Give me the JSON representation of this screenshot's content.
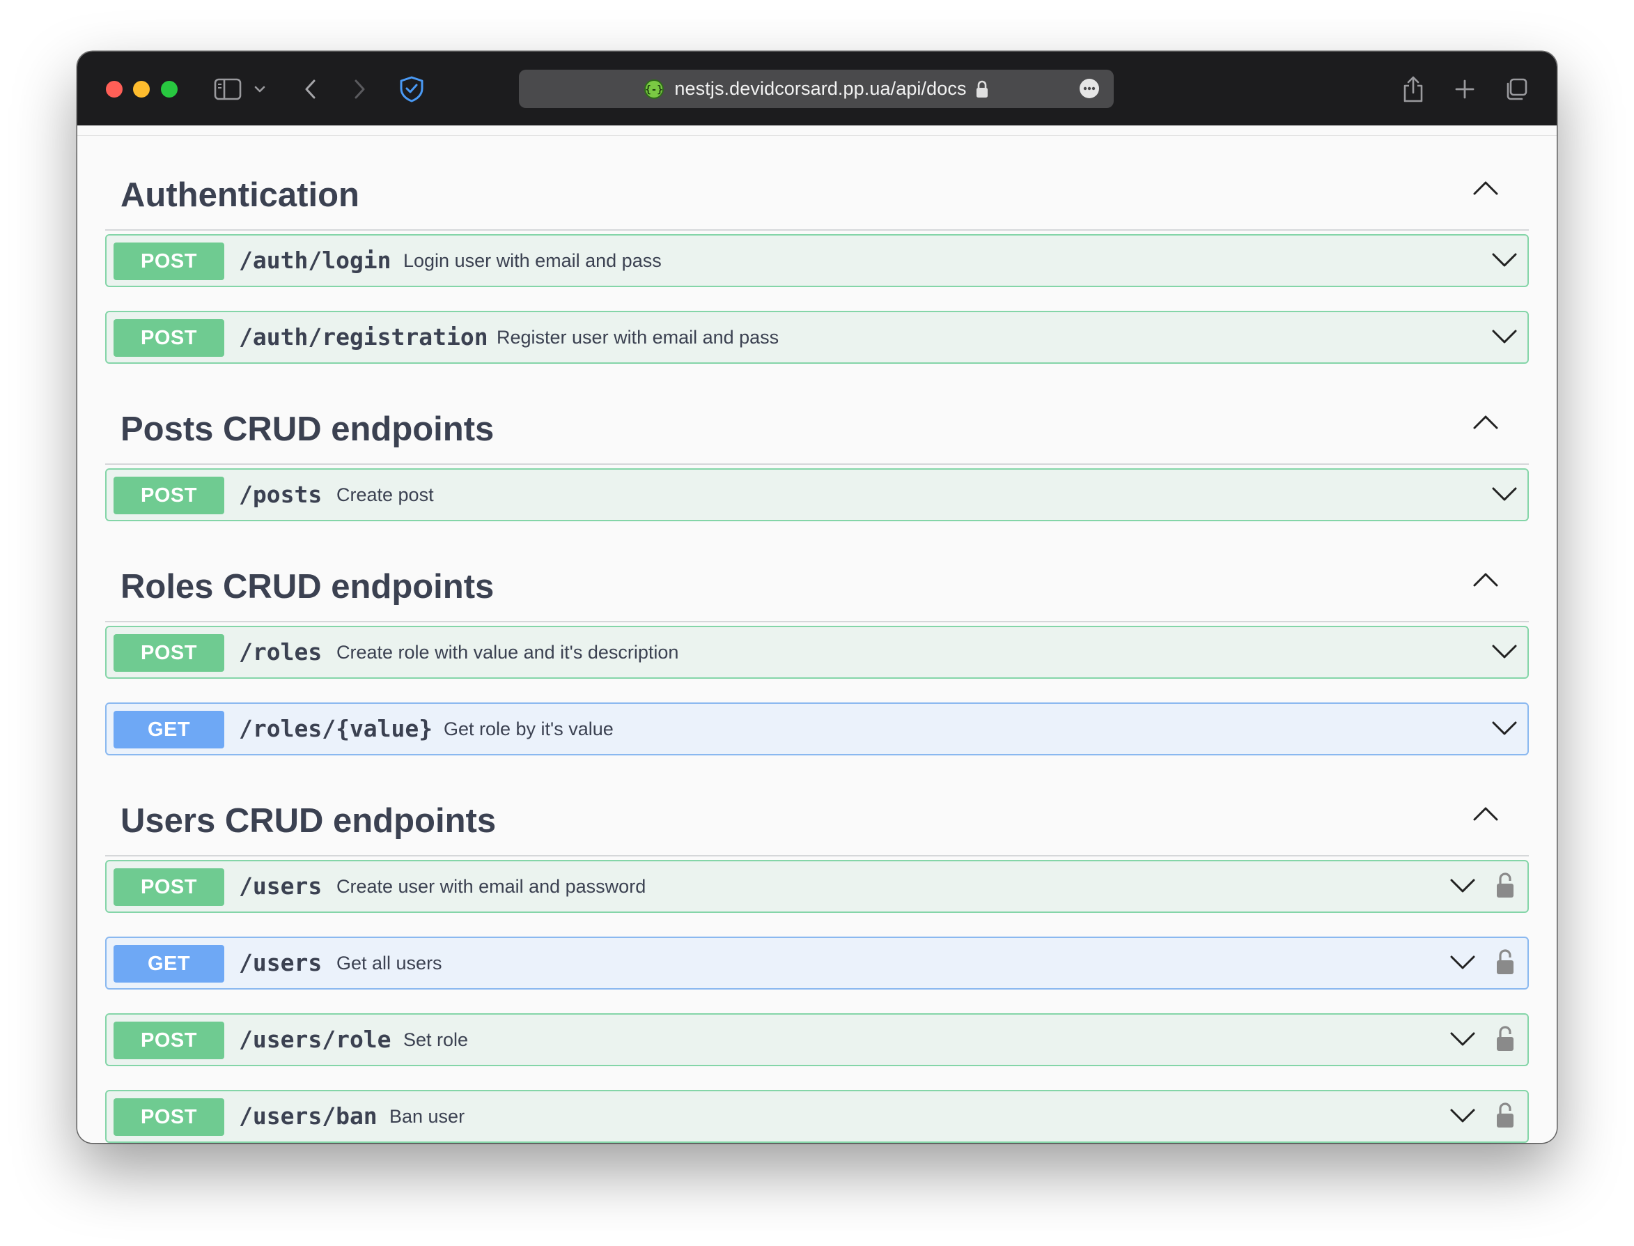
{
  "browser": {
    "url": "nestjs.devidcorsard.pp.ua/api/docs"
  },
  "sections": [
    {
      "title": "Authentication",
      "operations": [
        {
          "method": "POST",
          "path": "/auth/login",
          "summary": "Login user with email and pass",
          "locked": false
        },
        {
          "method": "POST",
          "path": "/auth/registration",
          "summary": "Register user with email and pass",
          "locked": false
        }
      ]
    },
    {
      "title": "Posts CRUD endpoints",
      "operations": [
        {
          "method": "POST",
          "path": "/posts",
          "summary": "Create post",
          "locked": false
        }
      ]
    },
    {
      "title": "Roles CRUD endpoints",
      "operations": [
        {
          "method": "POST",
          "path": "/roles",
          "summary": "Create role with value and it's description",
          "locked": false
        },
        {
          "method": "GET",
          "path": "/roles/{value}",
          "summary": "Get role by it's value",
          "locked": false
        }
      ]
    },
    {
      "title": "Users CRUD endpoints",
      "operations": [
        {
          "method": "POST",
          "path": "/users",
          "summary": "Create user with email and password",
          "locked": true
        },
        {
          "method": "GET",
          "path": "/users",
          "summary": "Get all users",
          "locked": true
        },
        {
          "method": "POST",
          "path": "/users/role",
          "summary": "Set role",
          "locked": true
        },
        {
          "method": "POST",
          "path": "/users/ban",
          "summary": "Ban user",
          "locked": true
        }
      ]
    }
  ],
  "colors": {
    "post_badge": "#6fcb91",
    "get_badge": "#6ea8f5",
    "post_bg": "#ebf3ef",
    "get_bg": "#ebf2fb",
    "heading": "#3b4151"
  },
  "icons": {
    "collapse": "chevron-up-icon",
    "expand": "chevron-down-icon",
    "auth": "padlock-icon"
  }
}
